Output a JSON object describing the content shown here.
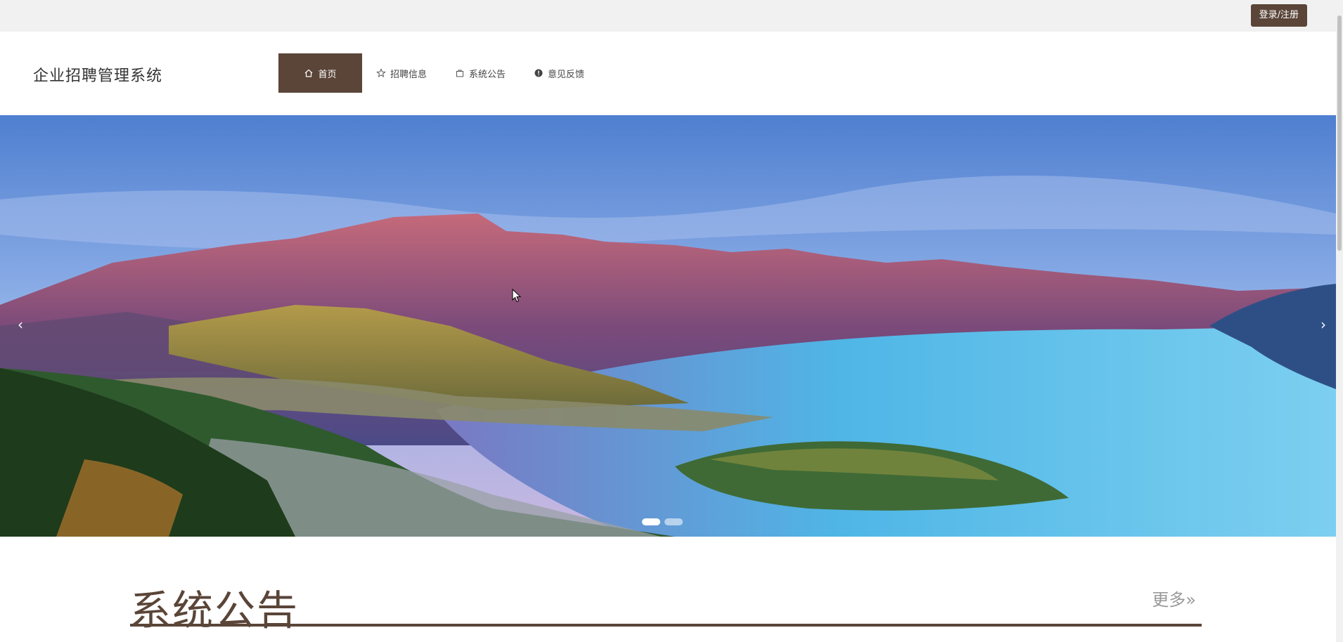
{
  "topbar": {
    "login_label": "登录/注册"
  },
  "header": {
    "site_title": "企业招聘管理系统"
  },
  "nav": {
    "items": [
      {
        "label": "首页",
        "icon": "home-icon",
        "active": true
      },
      {
        "label": "招聘信息",
        "icon": "star-icon",
        "active": false
      },
      {
        "label": "系统公告",
        "icon": "bag-icon",
        "active": false
      },
      {
        "label": "意见反馈",
        "icon": "alert-circle-icon",
        "active": false
      }
    ]
  },
  "banner": {
    "prev_icon": "chevron-left-icon",
    "next_icon": "chevron-right-icon",
    "prev_glyph": "‹",
    "next_glyph": "›",
    "slide_count": 2,
    "active_slide": 1
  },
  "section": {
    "title": "系统公告",
    "more_label": "更多»"
  },
  "colors": {
    "accent": "#5a4538",
    "topbar_bg": "#f1f1f1"
  }
}
